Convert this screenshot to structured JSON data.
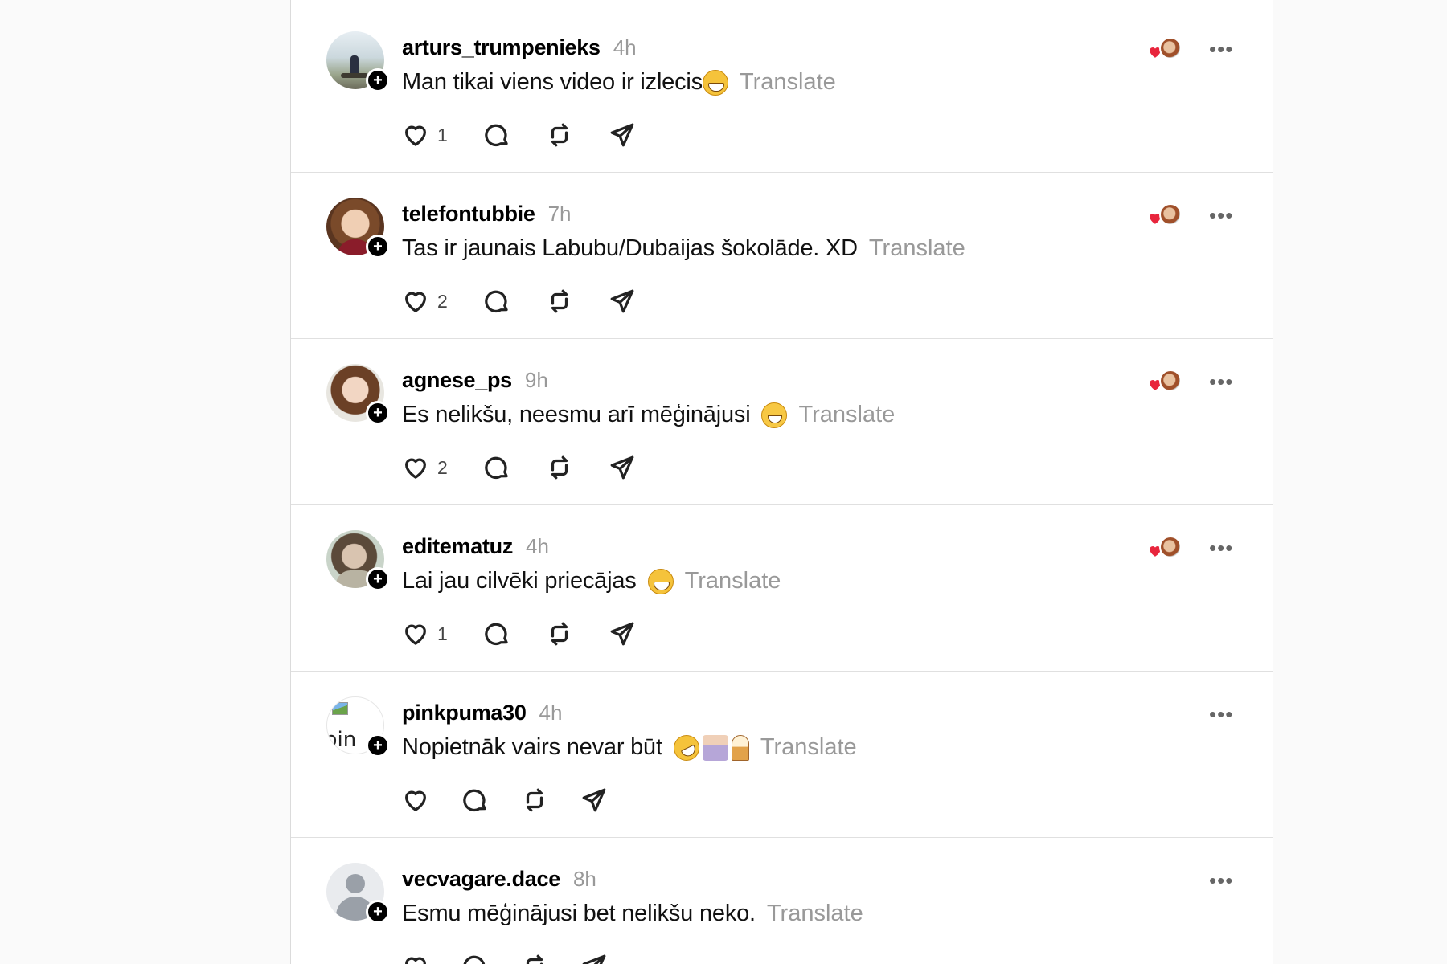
{
  "posts": [
    {
      "username": "arturs_trumpenieks",
      "time": "4h",
      "text": "Man tikai viens video ir izlecis",
      "emojis": [
        "grin"
      ],
      "translate": "Translate",
      "likes": "1",
      "has_likers": true
    },
    {
      "username": "telefontubbie",
      "time": "7h",
      "text": "Tas ir jaunais Labubu/Dubaijas šokolāde. XD",
      "emojis": [],
      "translate": "Translate",
      "likes": "2",
      "has_likers": true
    },
    {
      "username": "agnese_ps",
      "time": "9h",
      "text": "Es nelikšu, neesmu arī mēģinājusi",
      "emojis": [
        "smile"
      ],
      "translate": "Translate",
      "likes": "2",
      "has_likers": true
    },
    {
      "username": "editematuz",
      "time": "4h",
      "text": "Lai jau cilvēki priecājas",
      "emojis": [
        "grin"
      ],
      "translate": "Translate",
      "likes": "1",
      "has_likers": true
    },
    {
      "username": "pinkpuma30",
      "time": "4h",
      "text": "Nopietnāk vairs nevar būt",
      "emojis": [
        "rofl",
        "person",
        "icecream"
      ],
      "translate": "Translate",
      "likes": "",
      "has_likers": false,
      "avatar_alt": "pin"
    },
    {
      "username": "vecvagare.dace",
      "time": "8h",
      "text": "Esmu mēģinājusi bet nelikšu neko.",
      "emojis": [],
      "translate": "Translate",
      "likes": "",
      "has_likers": false
    }
  ],
  "colors": {
    "liker_heart": "#e8253c",
    "muted_text": "#999999",
    "divider": "#e0e0e0"
  }
}
